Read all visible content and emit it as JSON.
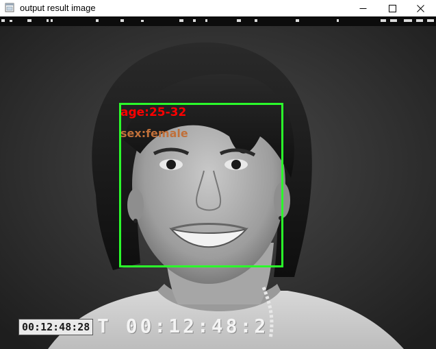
{
  "window": {
    "title": "output result image",
    "controls": {
      "minimize": "minimize",
      "maximize": "maximize",
      "close": "close"
    }
  },
  "icons": {
    "app": "app-window-icon",
    "minimize": "minimize-icon",
    "maximize": "maximize-icon",
    "close": "close-icon"
  },
  "detection": {
    "box_color": "#2bff2b",
    "age_text": "age:25-32",
    "age_color": "#ff0000",
    "sex_text": "sex:female",
    "sex_color": "#c0703a"
  },
  "overlay": {
    "timecode_small": "00:12:48:28",
    "timecode_large": "T 00:12:48:2"
  }
}
